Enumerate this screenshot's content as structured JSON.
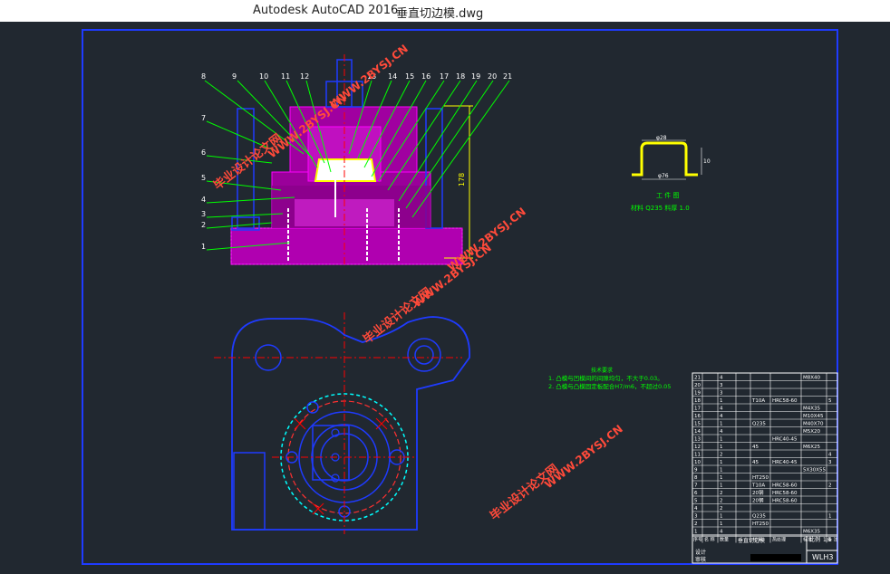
{
  "window": {
    "app_title": "Autodesk AutoCAD 2016",
    "file_name": "垂直切边模.dwg"
  },
  "drawing": {
    "balloons_top": [
      "8",
      "9",
      "10",
      "11",
      "12",
      "13",
      "14",
      "15",
      "16",
      "17",
      "18",
      "19",
      "20",
      "21"
    ],
    "balloons_left": [
      "7",
      "6",
      "5",
      "4",
      "3",
      "2",
      "1"
    ],
    "height_dim": "178",
    "part_caption": "工 件 图",
    "part_material": "材料 Q235  料厚 1.0",
    "part_dim_top": "φ28",
    "part_dim_side": "10",
    "part_dim_bottom": "φ76",
    "notes_title": "技术要求",
    "note_1": "1. 凸模与凹模间的间隙均匀，不大于0.03。",
    "note_2": "2. 凸模与凸模固定板配合H7/m6，不超过0.05"
  },
  "watermarks": [
    "毕业设计论文网",
    "WWW.2BYSJ.CN"
  ],
  "title_block": {
    "rows": [
      {
        "no": "21",
        "qty": "4",
        "mat": "",
        "heat": "",
        "std": "M8X40",
        "rem": ""
      },
      {
        "no": "20",
        "qty": "3",
        "mat": "",
        "heat": "",
        "std": "",
        "rem": ""
      },
      {
        "no": "19",
        "qty": "3",
        "mat": "",
        "heat": "",
        "std": "",
        "rem": ""
      },
      {
        "no": "18",
        "qty": "1",
        "mat": "T10A",
        "heat": "HRC58-60",
        "std": "",
        "rem": "5"
      },
      {
        "no": "17",
        "qty": "4",
        "mat": "",
        "heat": "",
        "std": "M4X35",
        "rem": ""
      },
      {
        "no": "16",
        "qty": "4",
        "mat": "",
        "heat": "",
        "std": "M10X45",
        "rem": ""
      },
      {
        "no": "15",
        "qty": "1",
        "mat": "Q235",
        "heat": "",
        "std": "M40X70",
        "rem": ""
      },
      {
        "no": "14",
        "qty": "4",
        "mat": "",
        "heat": "",
        "std": "M5X20",
        "rem": ""
      },
      {
        "no": "13",
        "qty": "1",
        "mat": "",
        "heat": "HRC40-45",
        "std": "",
        "rem": ""
      },
      {
        "no": "12",
        "qty": "1",
        "mat": "45",
        "heat": "",
        "std": "M6X25",
        "rem": ""
      },
      {
        "no": "11",
        "qty": "2",
        "mat": "",
        "heat": "",
        "std": "",
        "rem": "4"
      },
      {
        "no": "10",
        "qty": "1",
        "mat": "45",
        "heat": "HRC40-45",
        "std": "",
        "rem": "3"
      },
      {
        "no": "9",
        "qty": "1",
        "mat": "",
        "heat": "",
        "std": "5X30X55",
        "rem": ""
      },
      {
        "no": "8",
        "qty": "1",
        "mat": "HT250",
        "heat": "",
        "std": "",
        "rem": ""
      },
      {
        "no": "7",
        "qty": "1",
        "mat": "T10A",
        "heat": "HRC58-60",
        "std": "",
        "rem": "2"
      },
      {
        "no": "6",
        "qty": "2",
        "mat": "20钢",
        "heat": "HRC58-60",
        "std": "",
        "rem": ""
      },
      {
        "no": "5",
        "qty": "2",
        "mat": "20钢",
        "heat": "HRC58-60",
        "std": "",
        "rem": ""
      },
      {
        "no": "4",
        "qty": "2",
        "mat": "",
        "heat": "",
        "std": "",
        "rem": ""
      },
      {
        "no": "3",
        "qty": "1",
        "mat": "Q235",
        "heat": "",
        "std": "",
        "rem": "1"
      },
      {
        "no": "2",
        "qty": "1",
        "mat": "HT250",
        "heat": "",
        "std": "",
        "rem": ""
      },
      {
        "no": "1",
        "qty": "4",
        "mat": "",
        "heat": "",
        "std": "M6X35",
        "rem": ""
      }
    ],
    "header": {
      "no": "序号",
      "name": "名 称",
      "qty": "数量",
      "mat": "材 料",
      "heat": "热处理",
      "std": "标准",
      "rem": "备 注"
    },
    "title": "垂直切边模",
    "scale_label": "比例",
    "scale_value": "1:1",
    "drawing_no": "WLH3",
    "designer": "设计",
    "checker": "审核"
  },
  "colors": {
    "background": "#212830",
    "frame": "#1f3bff",
    "magenta": "#ff00ff",
    "green": "#00ff00",
    "yellow": "#ffff00",
    "red": "#ff0000",
    "cyan": "#00ffff",
    "white": "#ffffff",
    "watermark": "#e8392f"
  }
}
